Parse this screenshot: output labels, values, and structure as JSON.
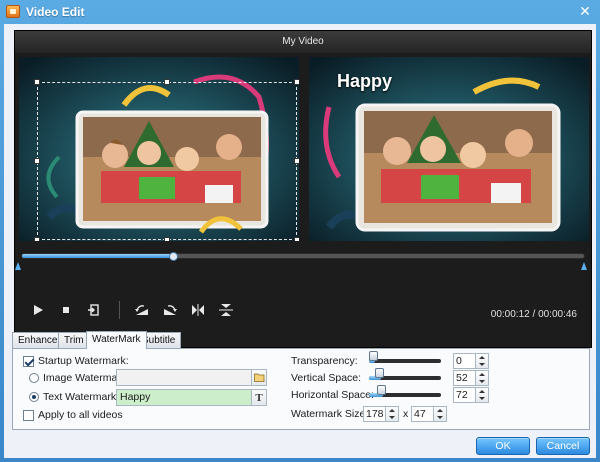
{
  "window": {
    "title": "Video Edit"
  },
  "player": {
    "video_title": "My Video",
    "progress_fraction": 0.27,
    "current_time": "00:00:12",
    "total_time": "00:00:46",
    "time_separator": " / "
  },
  "preview": {
    "watermark_text": "Happy"
  },
  "tabs": [
    {
      "label": "Enhance",
      "active": false
    },
    {
      "label": "Trim",
      "active": false
    },
    {
      "label": "WaterMark",
      "active": true
    },
    {
      "label": "Subtitle",
      "active": false
    }
  ],
  "watermark": {
    "startup_label": "Startup Watermark:",
    "startup_checked": true,
    "image_label": "Image Watermark:",
    "image_value": "",
    "text_label": "Text Watermark:",
    "text_value": "Happy",
    "text_selected": true,
    "apply_all_label": "Apply to all videos",
    "apply_all_checked": false,
    "transparency_label": "Transparency:",
    "transparency_value": "0",
    "vertical_label": "Vertical Space:",
    "vertical_value": "52",
    "horizontal_label": "Horizontal Space:",
    "horizontal_value": "72",
    "size_label": "Watermark Size:",
    "size_w": "178",
    "size_x": "x",
    "size_h": "47",
    "text_tool_glyph": "T",
    "folder_icon": "folder-icon"
  },
  "buttons": {
    "ok": "OK",
    "cancel": "Cancel"
  },
  "colors": {
    "accent": "#3a8fd4",
    "title_bar": "#4a9ad8",
    "text_field_active": "#cdeeca"
  }
}
